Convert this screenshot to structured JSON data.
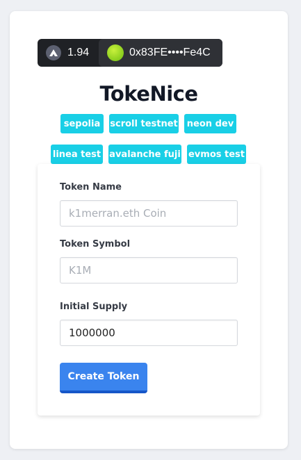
{
  "wallet": {
    "balance": "1.94",
    "balance_icon": "avalanche-icon",
    "address": "0x83FE••••Fe4C",
    "address_avatar_color": "#8fd61e"
  },
  "app": {
    "title": "TokeNice"
  },
  "chains": [
    "sepolia",
    "scroll testnet",
    "neon dev",
    "linea test",
    "avalanche fuji",
    "evmos test"
  ],
  "form": {
    "token_name_label": "Token Name",
    "token_name_placeholder": "k1merran.eth Coin",
    "token_name_value": "",
    "token_symbol_label": "Token Symbol",
    "token_symbol_placeholder": "K1M",
    "token_symbol_value": "",
    "initial_supply_label": "Initial Supply",
    "initial_supply_value": "1000000",
    "submit_label": "Create Token"
  },
  "colors": {
    "tag": "#19cfe6",
    "button": "#3a84ee",
    "wallet_bar": "#1f2125"
  }
}
